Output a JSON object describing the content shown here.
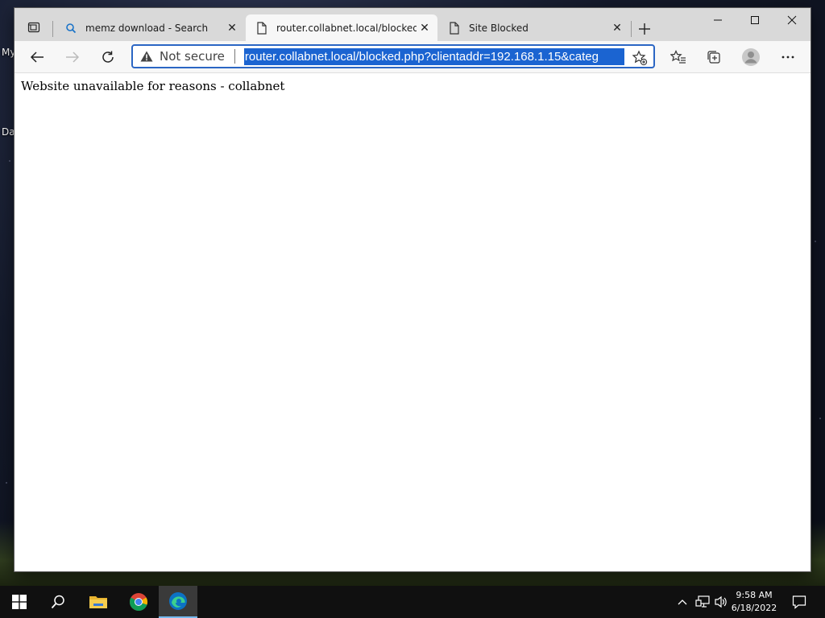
{
  "desktop": {
    "fragments": [
      "My",
      "Da"
    ]
  },
  "browser": {
    "tabs": [
      {
        "title": "memz download - Search",
        "icon": "search-icon",
        "active": false
      },
      {
        "title": "router.collabnet.local/blocked.php",
        "icon": "page-icon",
        "active": true
      },
      {
        "title": "Site Blocked",
        "icon": "page-icon",
        "active": false
      }
    ],
    "address_bar": {
      "security_label": "Not secure",
      "url": "router.collabnet.local/blocked.php?clientaddr=192.168.1.15&categ"
    },
    "page": {
      "message": "Website unavailable for reasons - collabnet"
    }
  },
  "taskbar": {
    "time": "9:58 AM",
    "date": "6/18/2022"
  },
  "colors": {
    "accent": "#1b64d1",
    "address_border": "#2b66c4"
  }
}
